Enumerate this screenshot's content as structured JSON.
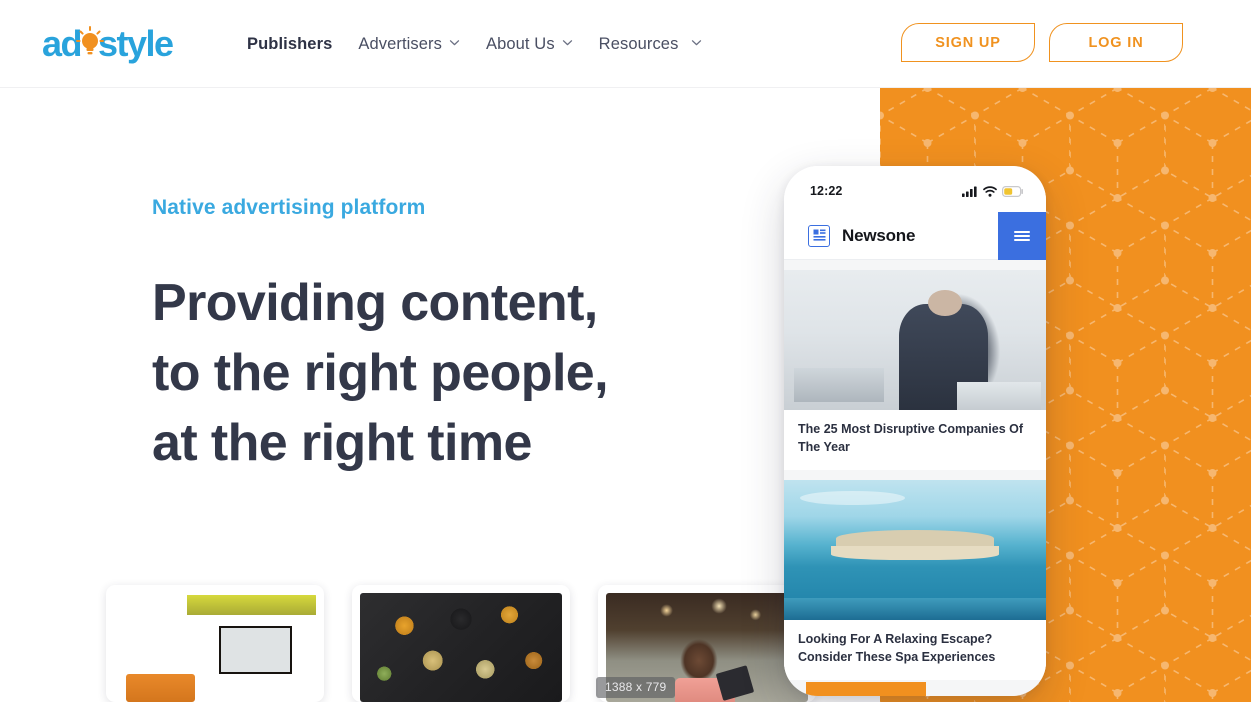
{
  "header": {
    "logo": {
      "text_a": "ad",
      "text_b": "style",
      "icon": "lightbulb-icon",
      "color_blue": "#29a3dc",
      "color_orange": "#f1901f"
    },
    "nav": [
      {
        "label": "Publishers",
        "active": true,
        "has_dropdown": false
      },
      {
        "label": "Advertisers",
        "active": false,
        "has_dropdown": true
      },
      {
        "label": "About Us",
        "active": false,
        "has_dropdown": true
      },
      {
        "label": "Resources",
        "active": false,
        "has_dropdown": true
      }
    ],
    "signup_label": "SIGN UP",
    "login_label": "LOG IN"
  },
  "hero": {
    "eyebrow": "Native advertising platform",
    "headline_line1": "Providing content,",
    "headline_line2": "to the right people,",
    "headline_line3": "at the right time"
  },
  "phone": {
    "status": {
      "time": "12:22",
      "signal": "cellular-bars-icon",
      "wifi": "wifi-icon",
      "battery": "battery-icon"
    },
    "app": {
      "title": "Newsone",
      "logo": "newsone-logo-icon",
      "menu": "hamburger-menu-icon"
    },
    "articles": [
      {
        "title": "The 25 Most Disruptive Companies Of The Year",
        "image": "businessman-in-office-photo"
      },
      {
        "title": "Looking For A Relaxing Escape? Consider These Spa Experiences",
        "image": "tropical-beach-umbrella-photo"
      }
    ]
  },
  "cards": [
    {
      "image": "home-theater-room-photo"
    },
    {
      "image": "assorted-food-containers-photo"
    },
    {
      "image": "child-looking-at-phone-photo"
    }
  ],
  "overlay": {
    "size_tooltip": "1388 x 779"
  },
  "colors": {
    "orange": "#f1901f",
    "blue_accent": "#3aa9e0",
    "headline_navy": "#333849",
    "app_blue": "#3b6fe0"
  }
}
